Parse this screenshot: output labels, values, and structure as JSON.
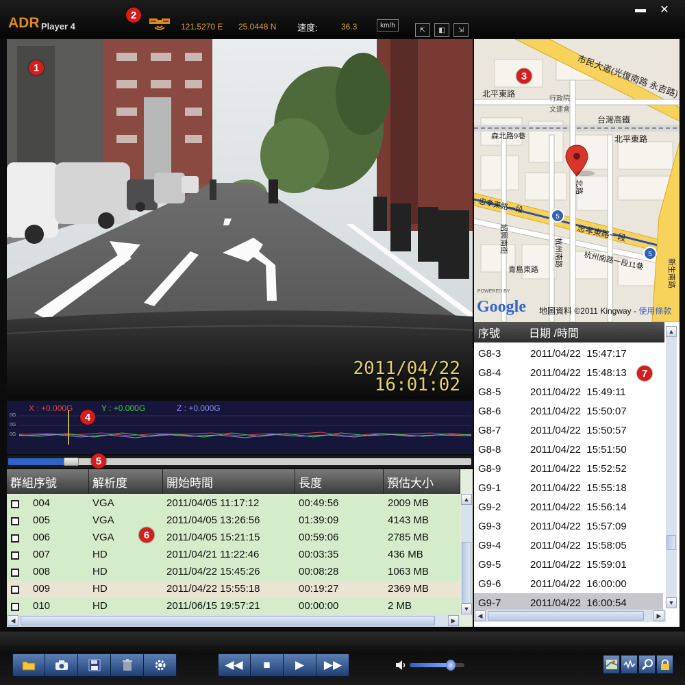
{
  "app": {
    "logo": "ADR",
    "product": "Player 4",
    "minimize": "▬",
    "close": "✕"
  },
  "gps": {
    "longitude": "121.5270 E",
    "latitude": "25.0448 N",
    "speed_label": "速度:",
    "speed_value": "36.3",
    "speed_unit": "km/h"
  },
  "view_buttons": [
    "⇱",
    "◧",
    "⇲"
  ],
  "video": {
    "date": "2011/04/22",
    "time": "16:01:02"
  },
  "map": {
    "roads": [
      "市民大道(光復南路 永吉路)",
      "北平東路",
      "台灣高鐵",
      "北平東路",
      "森北路9巷",
      "忠孝東路一段",
      "忠孝東路一段",
      "杭州南路一段11巷",
      "青島東路",
      "紹興南街",
      "杭州南路",
      "新生南路",
      "北路"
    ],
    "places": [
      "行政院",
      "文建會"
    ],
    "shields": [
      "5",
      "5"
    ],
    "powered_by": "POWERED BY",
    "logo": "Google",
    "attribution": "地圖資料 ©2011 Kingway - ",
    "terms_link": "使用條款"
  },
  "gsensor": {
    "x": "X : +0.000G",
    "y": "Y : +0.000G",
    "z": "Z : +0.000G",
    "ticks": [
      "0G",
      "0G",
      "0G"
    ]
  },
  "progress": {
    "value": 0.15
  },
  "group_table": {
    "headers": [
      "群組序號",
      "解析度",
      "開始時間",
      "長度",
      "預估大小"
    ],
    "rows": [
      {
        "id": "004",
        "res": "VGA",
        "start": "2011/04/05 11:17:12",
        "len": "00:49:56",
        "size": "2009 MB"
      },
      {
        "id": "005",
        "res": "VGA",
        "start": "2011/04/05 13:26:56",
        "len": "01:39:09",
        "size": "4143 MB"
      },
      {
        "id": "006",
        "res": "VGA",
        "start": "2011/04/05 15:21:15",
        "len": "00:59:06",
        "size": "2785 MB"
      },
      {
        "id": "007",
        "res": "HD",
        "start": "2011/04/21 11:22:46",
        "len": "00:03:35",
        "size": "436 MB"
      },
      {
        "id": "008",
        "res": "HD",
        "start": "2011/04/22 15:45:26",
        "len": "00:08:28",
        "size": "1063 MB"
      },
      {
        "id": "009",
        "res": "HD",
        "start": "2011/04/22 15:55:18",
        "len": "00:19:27",
        "size": "2369 MB"
      },
      {
        "id": "010",
        "res": "HD",
        "start": "2011/06/15 19:57:21",
        "len": "00:00:00",
        "size": "2 MB"
      }
    ]
  },
  "file_list": {
    "headers": [
      "序號",
      "日期 /時間"
    ],
    "rows": [
      {
        "id": "G8-3",
        "dt": "2011/04/22  15:47:17"
      },
      {
        "id": "G8-4",
        "dt": "2011/04/22  15:48:13"
      },
      {
        "id": "G8-5",
        "dt": "2011/04/22  15:49:11"
      },
      {
        "id": "G8-6",
        "dt": "2011/04/22  15:50:07"
      },
      {
        "id": "G8-7",
        "dt": "2011/04/22  15:50:57"
      },
      {
        "id": "G8-8",
        "dt": "2011/04/22  15:51:50"
      },
      {
        "id": "G8-9",
        "dt": "2011/04/22  15:52:52"
      },
      {
        "id": "G9-1",
        "dt": "2011/04/22  15:55:18"
      },
      {
        "id": "G9-2",
        "dt": "2011/04/22  15:56:14"
      },
      {
        "id": "G9-3",
        "dt": "2011/04/22  15:57:09"
      },
      {
        "id": "G9-4",
        "dt": "2011/04/22  15:58:05"
      },
      {
        "id": "G9-5",
        "dt": "2011/04/22  15:59:01"
      },
      {
        "id": "G9-6",
        "dt": "2011/04/22  16:00:00"
      },
      {
        "id": "G9-7",
        "dt": "2011/04/22  16:00:54"
      }
    ],
    "selected_index": 13
  },
  "volume": {
    "value": 0.75
  },
  "badges": [
    "1",
    "2",
    "3",
    "4",
    "5",
    "6",
    "7"
  ],
  "colors": {
    "accent": "#e08a1e",
    "badge": "#d61d1d",
    "gps_text": "#d9a23a",
    "row_green": "#d5ecca",
    "row_highlight": "#eae4d3",
    "list_selected": "#c6c6cc",
    "toolbar_blue": "#2f5590",
    "video_timestamp": "#e6d26b"
  }
}
